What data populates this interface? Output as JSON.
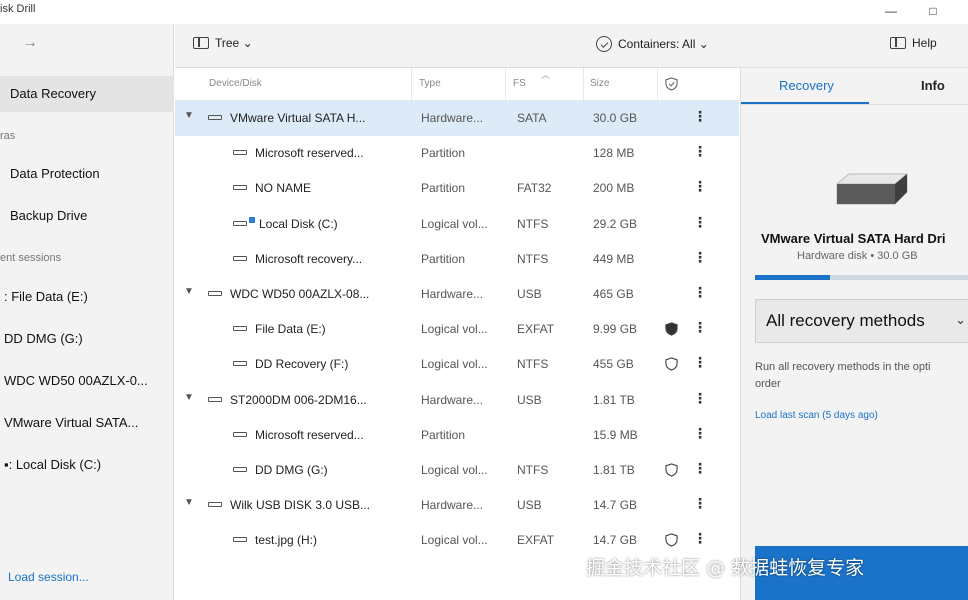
{
  "app": {
    "title": "isk Drill",
    "min_label": "—",
    "max_label": "□"
  },
  "toolbar": {
    "back_label": "→",
    "view_label": "Tree ⌄",
    "containers_label": "Containers: All ⌄",
    "help_label": "Help"
  },
  "sidebar": {
    "data_recovery": "Data Recovery",
    "extras_header": "ras",
    "data_protection": "Data Protection",
    "backup_drive": "Backup Drive",
    "recent_header": "ent sessions",
    "sessions": [
      ": File Data (E:)",
      "DD DMG (G:)",
      "WDC WD50 00AZLX-0...",
      "VMware Virtual SATA...",
      "▪: Local Disk (C:)"
    ],
    "load_session": "Load session..."
  },
  "list": {
    "headers": {
      "device": "Device/Disk",
      "type": "Type",
      "fs": "FS",
      "size": "Size"
    },
    "rows": [
      {
        "name": "VMware Virtual SATA H...",
        "type": "Hardware...",
        "fs": "SATA",
        "size": "30.0 GB",
        "level": 0,
        "expanded": true,
        "selected": true,
        "shield": ""
      },
      {
        "name": "Microsoft reserved...",
        "type": "Partition",
        "fs": "",
        "size": "128 MB",
        "level": 1,
        "shield": ""
      },
      {
        "name": "NO NAME",
        "type": "Partition",
        "fs": "FAT32",
        "size": "200 MB",
        "level": 1,
        "shield": ""
      },
      {
        "name": "Local Disk (C:)",
        "type": "Logical vol...",
        "fs": "NTFS",
        "size": "29.2 GB",
        "level": 1,
        "shield": "",
        "windows": true
      },
      {
        "name": "Microsoft recovery...",
        "type": "Partition",
        "fs": "NTFS",
        "size": "449 MB",
        "level": 1,
        "shield": ""
      },
      {
        "name": "WDC WD50 00AZLX-08...",
        "type": "Hardware...",
        "fs": "USB",
        "size": "465 GB",
        "level": 0,
        "expanded": true,
        "shield": ""
      },
      {
        "name": "File Data (E:)",
        "type": "Logical vol...",
        "fs": "EXFAT",
        "size": "9.99 GB",
        "level": 1,
        "shield": "filled"
      },
      {
        "name": "DD Recovery (F:)",
        "type": "Logical vol...",
        "fs": "NTFS",
        "size": "455 GB",
        "level": 1,
        "shield": "outline"
      },
      {
        "name": "ST2000DM 006-2DM16...",
        "type": "Hardware...",
        "fs": "USB",
        "size": "1.81 TB",
        "level": 0,
        "expanded": true,
        "shield": ""
      },
      {
        "name": "Microsoft reserved...",
        "type": "Partition",
        "fs": "",
        "size": "15.9 MB",
        "level": 1,
        "shield": ""
      },
      {
        "name": "DD DMG (G:)",
        "type": "Logical vol...",
        "fs": "NTFS",
        "size": "1.81 TB",
        "level": 1,
        "shield": "outline"
      },
      {
        "name": "Wilk USB DISK 3.0 USB...",
        "type": "Hardware...",
        "fs": "USB",
        "size": "14.7 GB",
        "level": 0,
        "expanded": true,
        "shield": ""
      },
      {
        "name": "test.jpg (H:)",
        "type": "Logical vol...",
        "fs": "EXFAT",
        "size": "14.7 GB",
        "level": 1,
        "shield": "outline"
      }
    ]
  },
  "panel": {
    "tab_recovery": "Recovery",
    "tab_info": "Info",
    "disk_name": "VMware Virtual SATA Hard Dri",
    "disk_sub": "Hardware disk • 30.0 GB",
    "progress_fraction": 0.35,
    "method": "All recovery methods",
    "method_caret": "⌄",
    "desc_line1": "Run all recovery methods in the opti",
    "desc_line2": "order",
    "last_scan": "Load last scan (5 days ago)"
  },
  "watermark": "掘金技术社区 @ 数据蛙恢复专家",
  "colors": {
    "accent": "#1a73c9",
    "selected_row": "#ddeaf7",
    "sidebar_bg": "#f3f3f3"
  }
}
